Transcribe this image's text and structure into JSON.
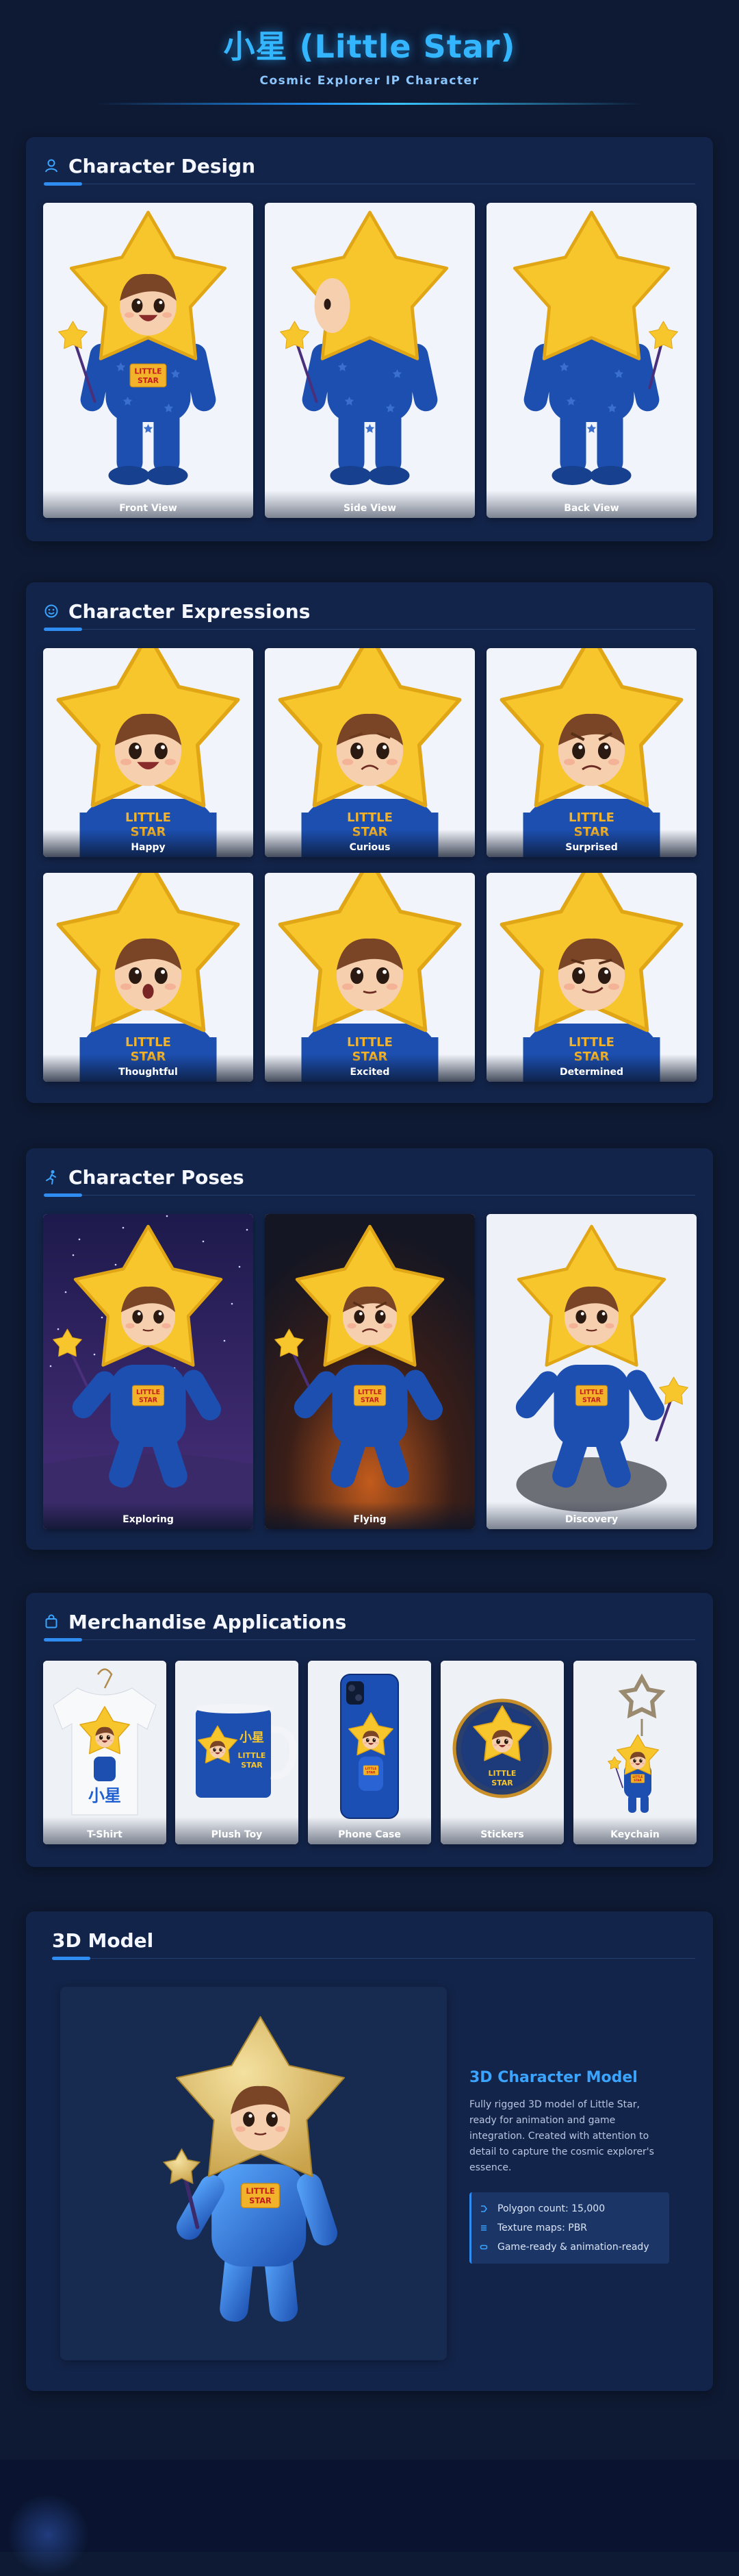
{
  "header": {
    "title": "小星 (Little Star)",
    "subtitle": "Cosmic Explorer IP Character"
  },
  "sections": {
    "design": {
      "title": "Character Design",
      "icon": "person-outline-icon",
      "views": [
        "Front View",
        "Side View",
        "Back View"
      ]
    },
    "expressions": {
      "title": "Character Expressions",
      "icon": "smiley-icon",
      "items": [
        "Happy",
        "Curious",
        "Surprised",
        "Thoughtful",
        "Excited",
        "Determined"
      ]
    },
    "poses": {
      "title": "Character Poses",
      "icon": "running-person-icon",
      "items": [
        "Exploring",
        "Flying",
        "Discovery"
      ]
    },
    "merch": {
      "title": "Merchandise Applications",
      "icon": "shopping-bag-icon",
      "items": [
        "T-Shirt",
        "Plush Toy",
        "Phone Case",
        "Stickers",
        "Keychain"
      ]
    },
    "model": {
      "title": "3D Model",
      "info_title": "3D Character Model",
      "description": "Fully rigged 3D model of Little Star, ready for animation and game integration. Created with attention to detail to capture the cosmic explorer's essence.",
      "specs": [
        "Polygon count: 15,000",
        "Texture maps: PBR",
        "Game-ready & animation-ready"
      ]
    }
  },
  "badge_text": "LITTLE STAR",
  "merch_text": "小星",
  "colors": {
    "accent": "#2f8cf0",
    "title": "#33b6ff",
    "star_yellow": "#f7c52c",
    "suit_blue": "#1c4fb0",
    "panel": "#13244a",
    "background": "#0e1a33"
  }
}
